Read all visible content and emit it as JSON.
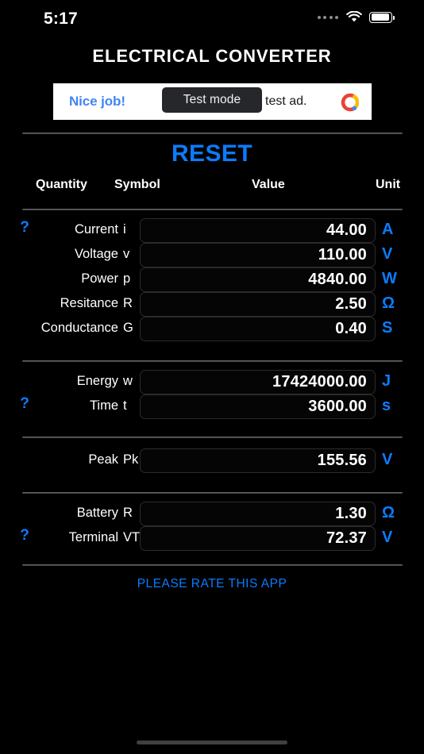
{
  "status_bar": {
    "time": "5:17",
    "signal_dots": 4,
    "wifi_icon": "wifi-icon",
    "battery_icon": "battery-full-icon"
  },
  "header": {
    "title": "ELECTRICAL CONVERTER"
  },
  "ad": {
    "headline": "Nice job!",
    "body": "test ad.",
    "badge": "Test mode",
    "logo": "admob-logo-icon",
    "colors": {
      "headline": "#4285f4",
      "background": "#ffffff",
      "badge_bg": "#26272b"
    }
  },
  "reset": {
    "label": "RESET",
    "color": "#0b7cff"
  },
  "columns": {
    "quantity": "Quantity",
    "symbol": "Symbol",
    "value": "Value",
    "unit": "Unit"
  },
  "help_glyph": "?",
  "groups": [
    {
      "rows": [
        {
          "quantity": "Current",
          "symbol": "i",
          "value": "44.00",
          "unit": "A",
          "help": true
        },
        {
          "quantity": "Voltage",
          "symbol": "v",
          "value": "110.00",
          "unit": "V",
          "help": false
        },
        {
          "quantity": "Power",
          "symbol": "p",
          "value": "4840.00",
          "unit": "W",
          "help": false
        },
        {
          "quantity": "Resitance",
          "symbol": "R",
          "value": "2.50",
          "unit": "Ω",
          "help": false
        },
        {
          "quantity": "Conductance",
          "symbol": "G",
          "value": "0.40",
          "unit": "S",
          "help": false
        }
      ]
    },
    {
      "rows": [
        {
          "quantity": "Energy",
          "symbol": "w",
          "value": "17424000.00",
          "unit": "J",
          "help": false
        },
        {
          "quantity": "Time",
          "symbol": "t",
          "value": "3600.00",
          "unit": "s",
          "help": true
        }
      ]
    },
    {
      "rows": [
        {
          "quantity": "Peak",
          "symbol": "Pk",
          "value": "155.56",
          "unit": "V",
          "help": false
        }
      ]
    },
    {
      "rows": [
        {
          "quantity": "Battery",
          "symbol": "R",
          "value": "1.30",
          "unit": "Ω",
          "help": false
        },
        {
          "quantity": "Terminal",
          "symbol": "VT",
          "value": "72.37",
          "unit": "V",
          "help": true
        }
      ]
    }
  ],
  "rate": {
    "label": "PLEASE RATE THIS APP",
    "color": "#0b7cff"
  },
  "layout": {
    "divider_tops": [
      167,
      263,
      437,
      455,
      545,
      563,
      621,
      711
    ],
    "group_row_tops": [
      [
        275,
        306,
        337,
        368,
        399
      ],
      [
        466,
        497
      ],
      [
        565
      ],
      [
        632,
        663
      ]
    ]
  }
}
